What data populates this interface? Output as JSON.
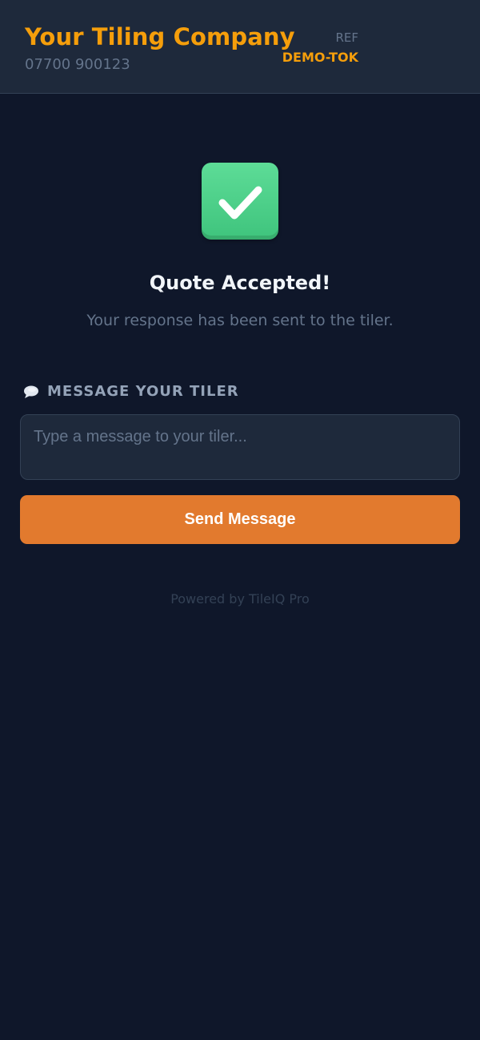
{
  "header": {
    "company_name": "Your Tiling Company",
    "phone": "07700 900123",
    "ref_label": "REF",
    "ref_value": "DEMO-TOK"
  },
  "status": {
    "icon": "check-icon",
    "title": "Quote Accepted!",
    "subtitle": "Your response has been sent to the tiler."
  },
  "message": {
    "icon": "speech-bubble-icon",
    "label": "MESSAGE YOUR TILER",
    "input_value": "",
    "input_placeholder": "Type a message to your tiler...",
    "send_label": "Send Message"
  },
  "footer": {
    "text": "Powered by TileIQ Pro"
  },
  "colors": {
    "background": "#0f172a",
    "header_background": "#1e293b",
    "brand_accent": "#f59e0b",
    "success": "#4ad088",
    "button": "#e27a2e"
  }
}
